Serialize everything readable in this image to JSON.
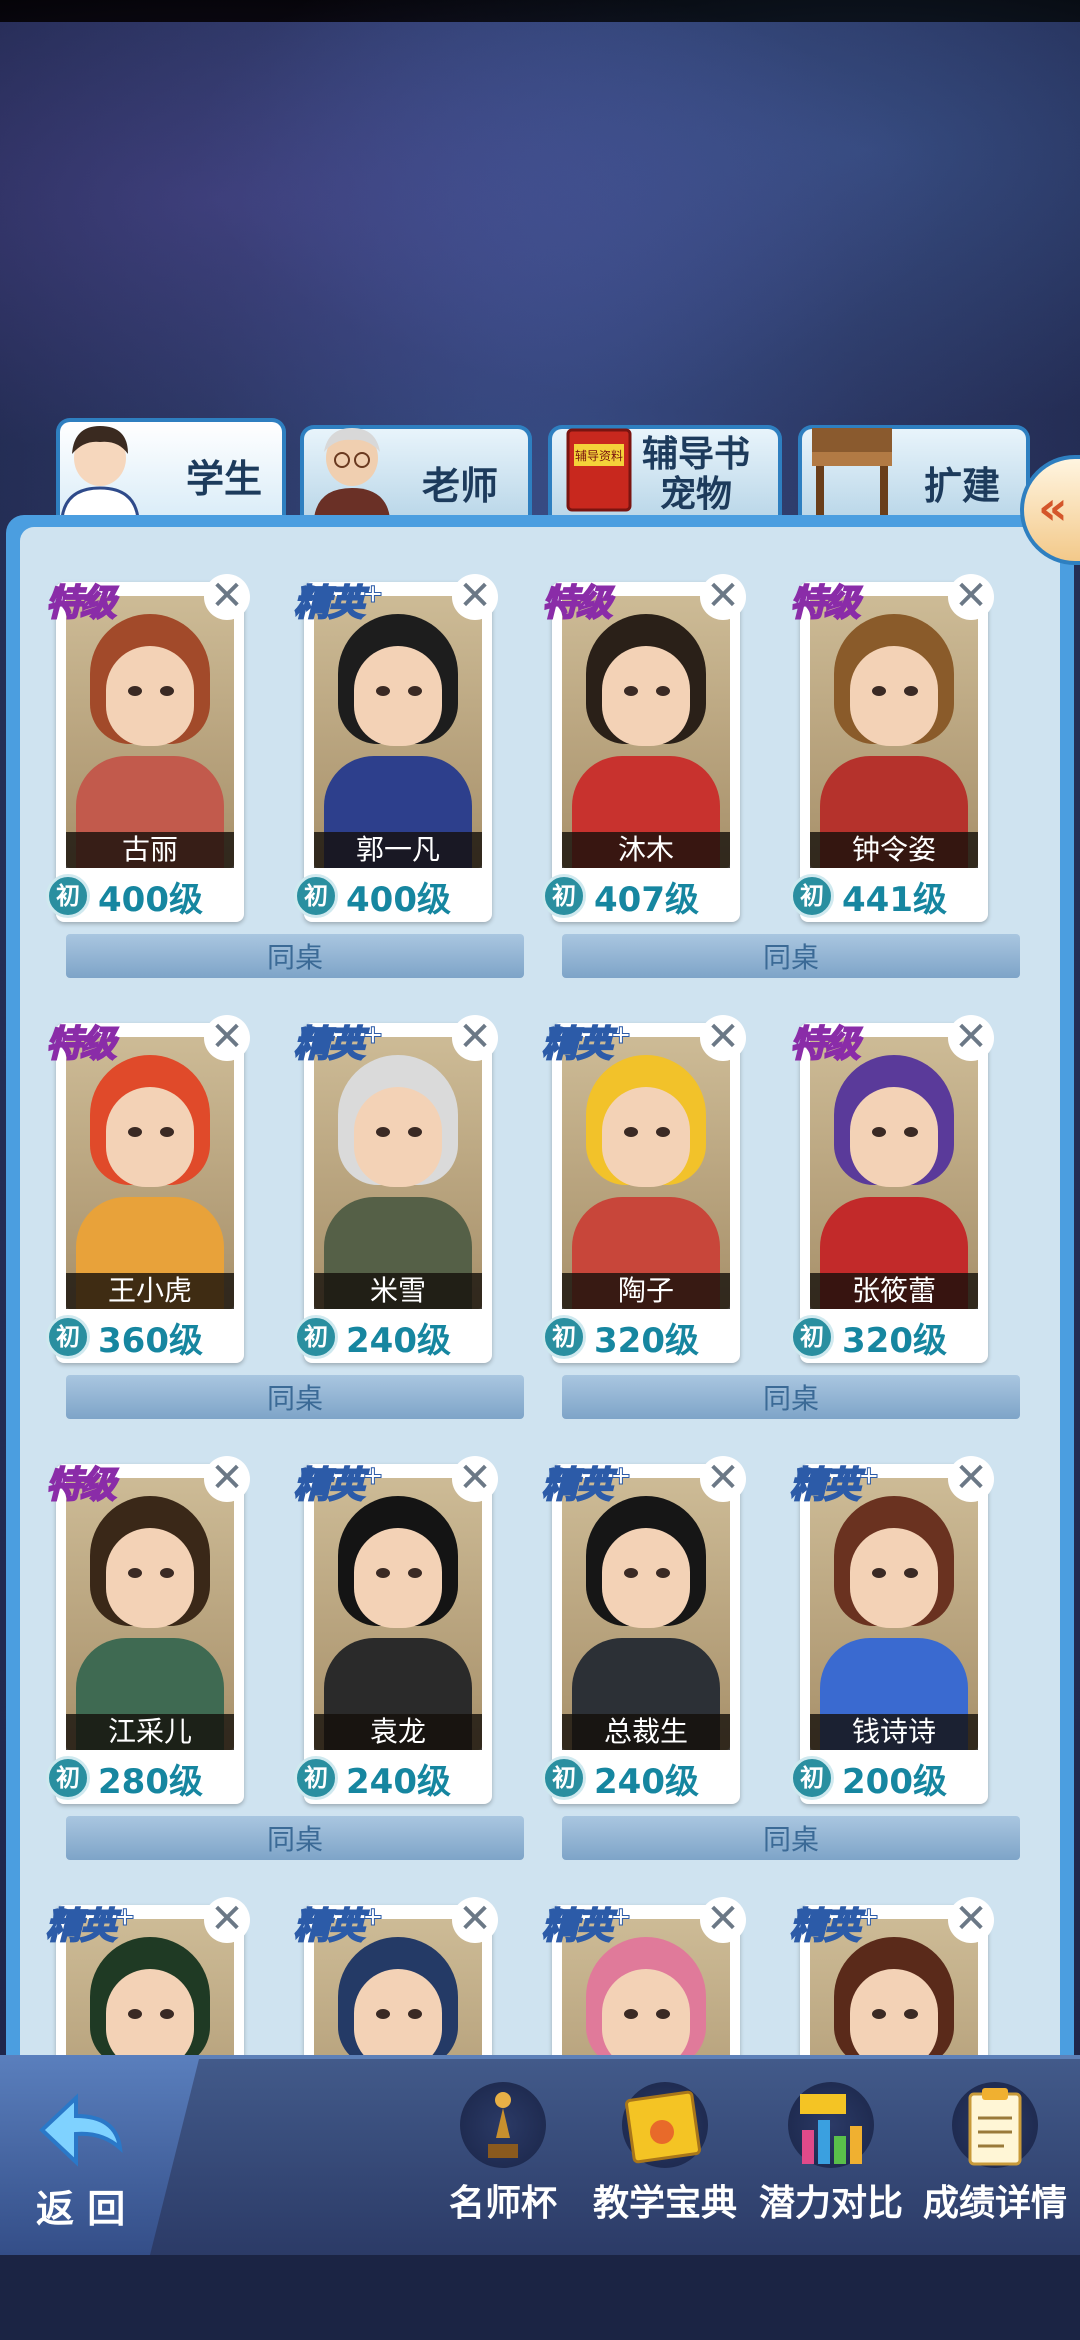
{
  "tabs": [
    {
      "label": "学生",
      "active": true
    },
    {
      "label": "老师",
      "active": false
    },
    {
      "label": "辅导书",
      "label2": "宠物",
      "active": false
    },
    {
      "label": "扩建",
      "active": false
    }
  ],
  "tab_icons": {
    "book_title": "辅导资料"
  },
  "side_button": {
    "icon": "double-chevron-left-icon",
    "glyph": "«"
  },
  "desk_label": "同桌",
  "close_glyph": "✕",
  "badge_label": "初",
  "rank_special": "特级",
  "rank_elite": "精英",
  "rank_elite_plus": "+",
  "students": [
    {
      "name": "古丽",
      "level": "400级",
      "rank": "special",
      "palette": {
        "hair": "#a24a2a",
        "body": "#c25a4c"
      }
    },
    {
      "name": "郭一凡",
      "level": "400级",
      "rank": "elite",
      "palette": {
        "hair": "#1d1d1d",
        "body": "#2d3f8c"
      }
    },
    {
      "name": "沐木",
      "level": "407级",
      "rank": "special",
      "palette": {
        "hair": "#2a2018",
        "body": "#c8322e"
      }
    },
    {
      "name": "钟令姿",
      "level": "441级",
      "rank": "special",
      "palette": {
        "hair": "#8a5b2a",
        "body": "#b5322c"
      }
    },
    {
      "name": "王小虎",
      "level": "360级",
      "rank": "special",
      "palette": {
        "hair": "#e04a2a",
        "body": "#e8a23a"
      }
    },
    {
      "name": "米雪",
      "level": "240级",
      "rank": "elite",
      "palette": {
        "hair": "#dadada",
        "body": "#556047"
      }
    },
    {
      "name": "陶子",
      "level": "320级",
      "rank": "elite",
      "palette": {
        "hair": "#f2c22a",
        "body": "#c8463a"
      }
    },
    {
      "name": "张筱蕾",
      "level": "320级",
      "rank": "special",
      "palette": {
        "hair": "#5a3a9a",
        "body": "#c22a2a"
      }
    },
    {
      "name": "江采儿",
      "level": "280级",
      "rank": "special",
      "palette": {
        "hair": "#3a2818",
        "body": "#3f6a52"
      }
    },
    {
      "name": "袁龙",
      "level": "240级",
      "rank": "elite",
      "palette": {
        "hair": "#141414",
        "body": "#2a2a2a"
      }
    },
    {
      "name": "总裁生",
      "level": "240级",
      "rank": "elite",
      "palette": {
        "hair": "#161616",
        "body": "#2c3036"
      }
    },
    {
      "name": "钱诗诗",
      "level": "200级",
      "rank": "elite",
      "palette": {
        "hair": "#6a3220",
        "body": "#3a6ad0"
      }
    },
    {
      "name": "",
      "level": "",
      "rank": "elite",
      "palette": {
        "hair": "#1f3a24",
        "body": "#c0682a"
      }
    },
    {
      "name": "",
      "level": "",
      "rank": "elite",
      "palette": {
        "hair": "#243a66",
        "body": "#e8e8e8"
      }
    },
    {
      "name": "",
      "level": "",
      "rank": "elite",
      "palette": {
        "hair": "#e07a9a",
        "body": "#3a3a8a"
      }
    },
    {
      "name": "",
      "level": "",
      "rank": "elite",
      "palette": {
        "hair": "#5a2a1a",
        "body": "#a8303a"
      }
    }
  ],
  "bottom_nav": {
    "back": "返 回",
    "items": [
      {
        "label": "名师杯",
        "icon": "trophy-icon"
      },
      {
        "label": "教学宝典",
        "icon": "book-icon"
      },
      {
        "label": "潜力对比",
        "icon": "bar-chart-icon"
      },
      {
        "label": "成绩详情",
        "icon": "report-icon"
      }
    ]
  }
}
